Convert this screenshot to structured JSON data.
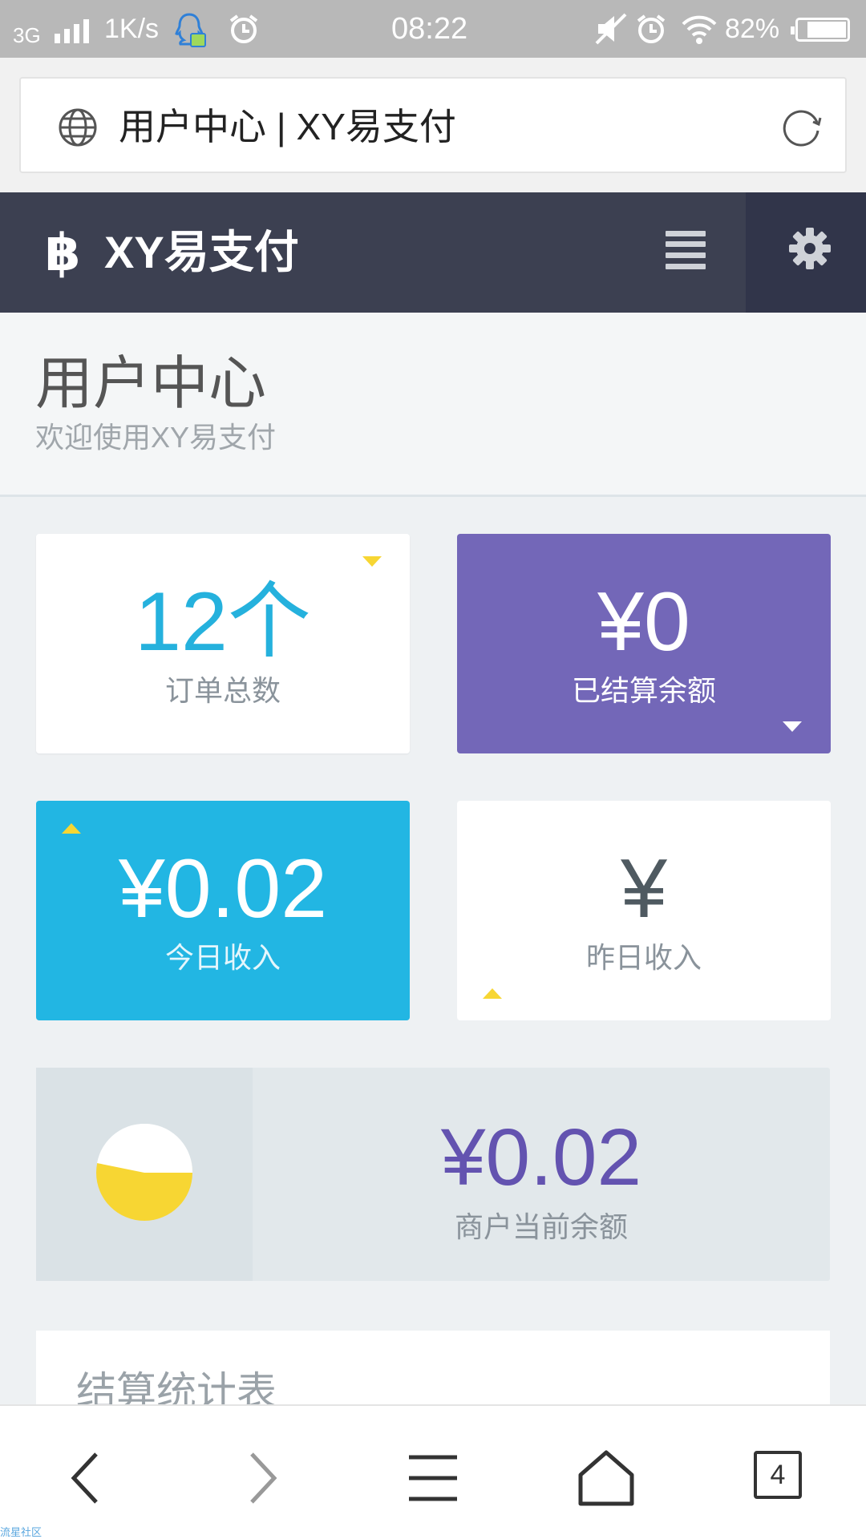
{
  "status_bar": {
    "network": "3G",
    "speed": "1K/s",
    "time": "08:22",
    "battery": "82%",
    "battery_level": 0.82,
    "icons": [
      "signal-icon",
      "qq-icon",
      "alarm-icon",
      "mute-icon",
      "alarm-icon",
      "wifi-icon",
      "battery-icon"
    ]
  },
  "address_bar": {
    "title": "用户中心 | XY易支付",
    "icons": [
      "globe-icon",
      "reload-icon"
    ]
  },
  "app_header": {
    "logo_glyph": "฿",
    "brand": "XY易支付",
    "icons": [
      "bitcoin-icon",
      "menu-icon",
      "gear-icon"
    ]
  },
  "page_header": {
    "title": "用户中心",
    "subtitle": "欢迎使用XY易支付"
  },
  "stats": [
    {
      "value": "12个",
      "label": "订单总数"
    },
    {
      "value": "¥0",
      "label": "已结算余额"
    },
    {
      "value": "¥0.02",
      "label": "今日收入"
    },
    {
      "value": "¥",
      "label": "昨日收入"
    }
  ],
  "balance": {
    "value": "¥0.02",
    "label": "商户当前余额",
    "icon": "pie-chart-icon"
  },
  "settlement_table": {
    "title": "结算统计表"
  },
  "bottom_nav": {
    "tab_count": "4",
    "icons": [
      "back-icon",
      "forward-icon",
      "menu-icon",
      "home-icon",
      "tabs-icon"
    ]
  },
  "watermark": "流星社区",
  "colors": {
    "header_bg": "#3c4051",
    "purple": "#7367b8",
    "cyan": "#22b6e3",
    "yellow": "#f7d633",
    "balance_text": "#6353b0"
  }
}
